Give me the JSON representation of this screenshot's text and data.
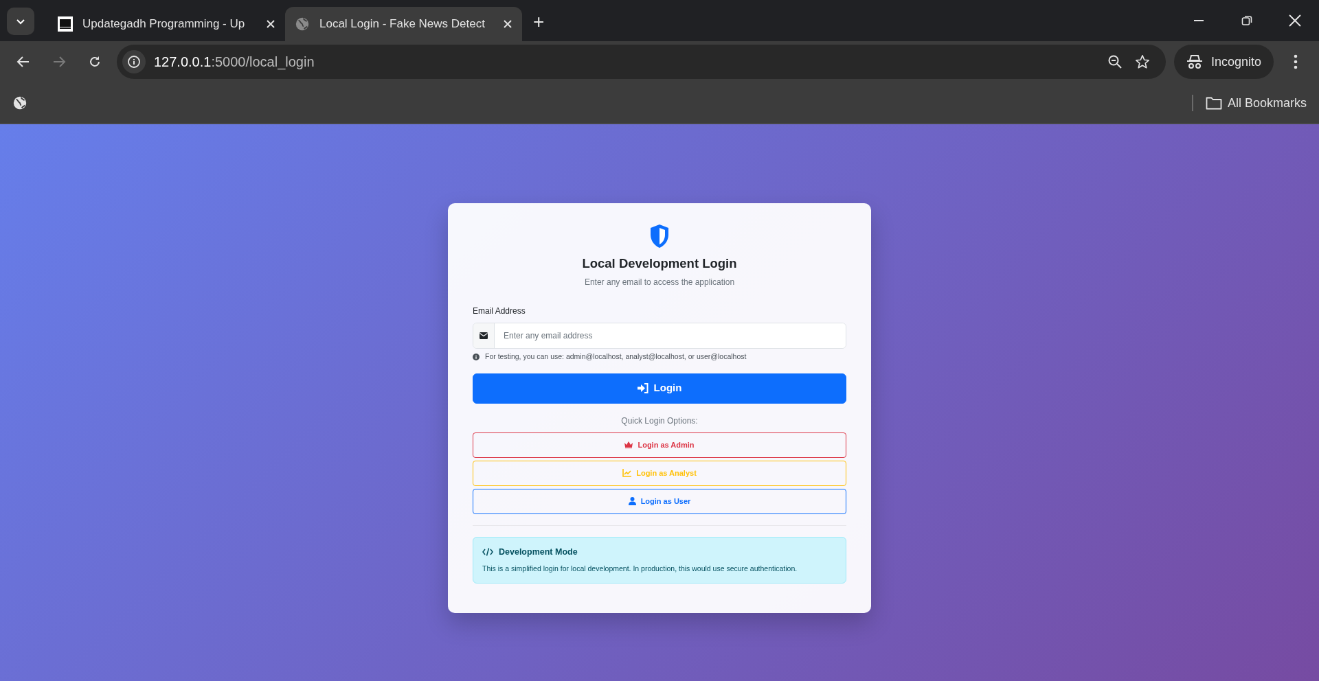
{
  "browser": {
    "tabs": [
      {
        "title": "Updategadh Programming - Up",
        "selected": false,
        "kind": "logo"
      },
      {
        "title": "Local Login - Fake News Detect",
        "selected": true,
        "kind": "globe"
      }
    ],
    "new_tab_label": "+",
    "address": {
      "host": "127.0.0.1",
      "rest": ":5000/local_login"
    },
    "profile_label": "Incognito",
    "bookmarks_label": "All Bookmarks"
  },
  "login_card": {
    "title": "Local Development Login",
    "subtitle": "Enter any email to access the application",
    "email_label": "Email Address",
    "email_placeholder": "Enter any email address",
    "hint": "For testing, you can use: admin@localhost, analyst@localhost, or user@localhost",
    "login_button": "Login",
    "quick_title": "Quick Login Options:",
    "quick_buttons": [
      {
        "label": "Login as Admin",
        "kind": "admin"
      },
      {
        "label": "Login as Analyst",
        "kind": "analyst"
      },
      {
        "label": "Login as User",
        "kind": "user"
      }
    ],
    "notice": {
      "title": "Development Mode",
      "text": "This is a simplified login for local development. In production, this would use secure authentication."
    }
  }
}
